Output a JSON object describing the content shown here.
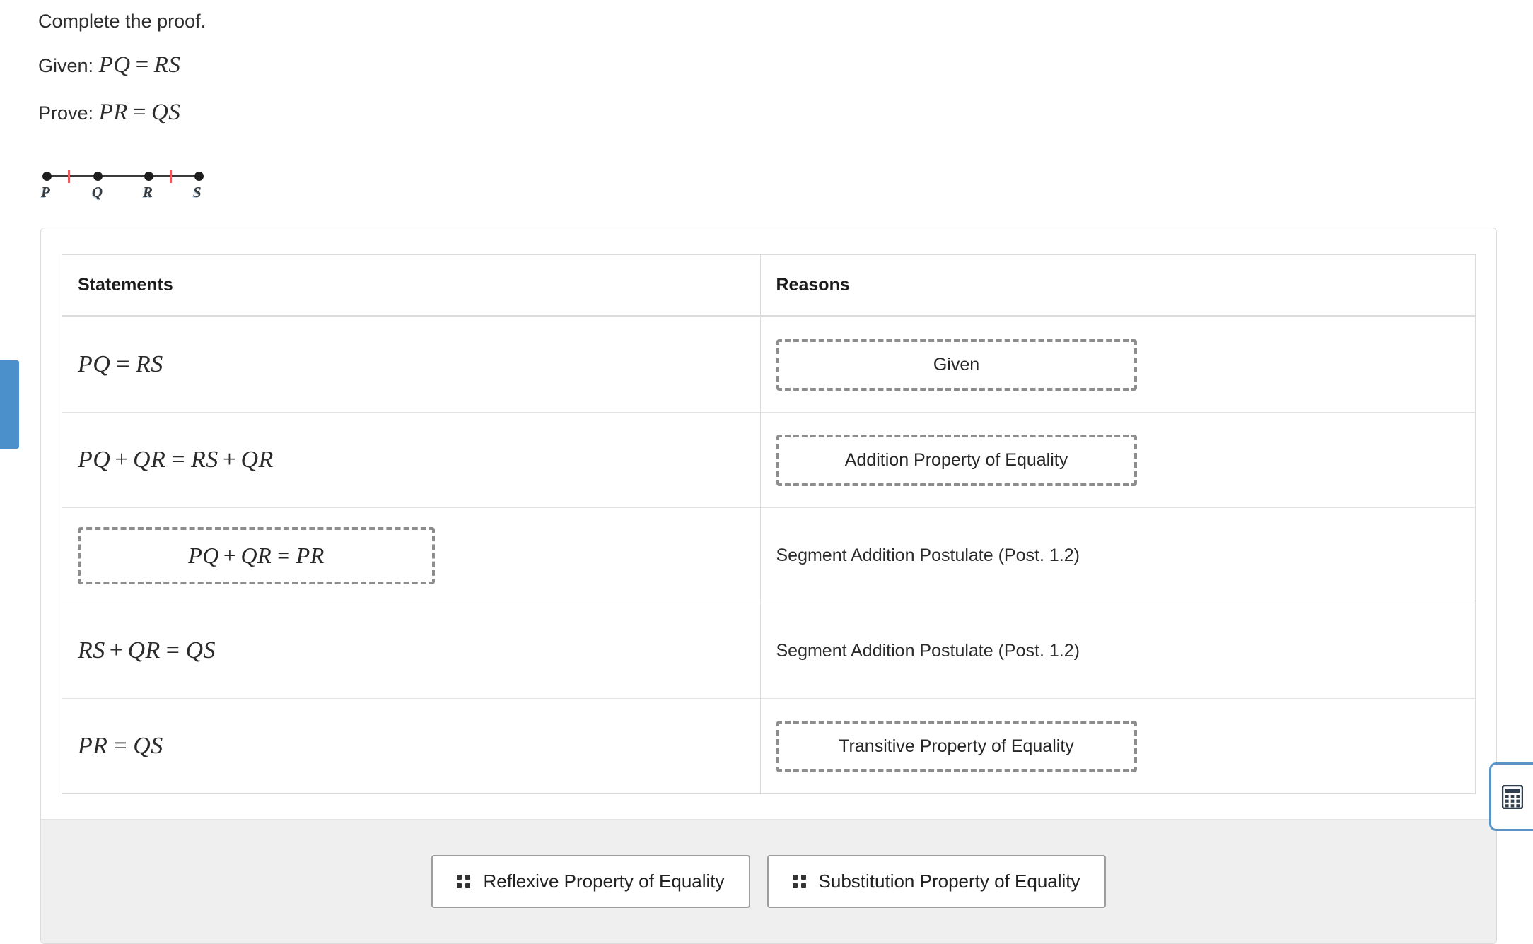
{
  "prompt": {
    "instruction": "Complete the proof.",
    "given_label": "Given:",
    "given_math": "PQ = RS",
    "prove_label": "Prove:",
    "prove_math": "PR = QS"
  },
  "figure": {
    "name": "number-line-PQRS",
    "points": [
      "P",
      "Q",
      "R",
      "S"
    ],
    "tick_color": "#f05a5a",
    "line_color": "#3a3a3a"
  },
  "table": {
    "headers": {
      "statements": "Statements",
      "reasons": "Reasons"
    },
    "rows": [
      {
        "statement": "PQ = RS",
        "statement_is_slot": false,
        "reason": "Given",
        "reason_is_slot": true
      },
      {
        "statement": "PQ + QR = RS + QR",
        "statement_is_slot": false,
        "reason": "Addition Property of Equality",
        "reason_is_slot": true
      },
      {
        "statement": "PQ + QR = PR",
        "statement_is_slot": true,
        "reason": "Segment Addition Postulate (Post. 1.2)",
        "reason_is_slot": false
      },
      {
        "statement": "RS + QR = QS",
        "statement_is_slot": false,
        "reason": "Segment Addition Postulate (Post. 1.2)",
        "reason_is_slot": false
      },
      {
        "statement": "PR = QS",
        "statement_is_slot": false,
        "reason": "Transitive Property of Equality",
        "reason_is_slot": true
      }
    ]
  },
  "tray": {
    "chips": [
      {
        "label": "Reflexive Property of Equality",
        "icon": "drag-handle-icon"
      },
      {
        "label": "Substitution Property of Equality",
        "icon": "drag-handle-icon"
      }
    ]
  },
  "flyout": {
    "icon": "calculator-icon"
  },
  "side_tab": {
    "color": "#4b8fcb"
  },
  "colors": {
    "accent_blue": "#4b8fcb",
    "tick_red": "#f05a5a",
    "tray_bg": "#efefef",
    "slot_dash": "#8d8d8d",
    "card_border": "#dcdcdc"
  }
}
